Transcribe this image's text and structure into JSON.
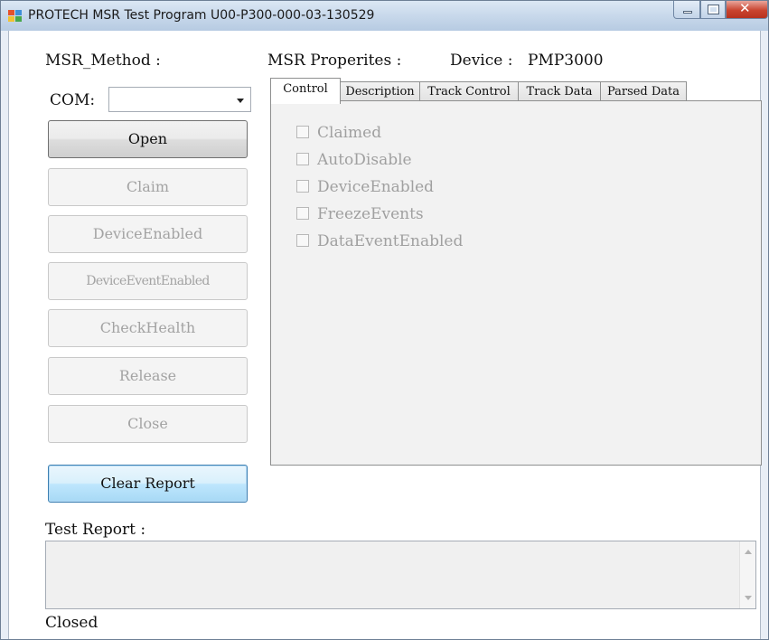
{
  "window": {
    "title": "PROTECH MSR Test Program U00-P300-000-03-130529"
  },
  "method": {
    "label": "MSR_Method :",
    "com_label": "COM:",
    "com_value": "",
    "buttons": {
      "open": "Open",
      "claim": "Claim",
      "device_enabled": "DeviceEnabled",
      "device_event_enabled": "DeviceEventEnabled",
      "check_health": "CheckHealth",
      "release": "Release",
      "close": "Close",
      "clear_report": "Clear Report"
    }
  },
  "properties": {
    "label": "MSR Properites :",
    "device_label": "Device :",
    "device_value": "PMP3000",
    "tabs": [
      {
        "label": "Control",
        "active": true
      },
      {
        "label": "Description",
        "active": false
      },
      {
        "label": "Track Control",
        "active": false
      },
      {
        "label": "Track Data",
        "active": false
      },
      {
        "label": "Parsed Data",
        "active": false
      }
    ],
    "checkboxes": [
      {
        "label": "Claimed",
        "checked": false
      },
      {
        "label": "AutoDisable",
        "checked": false
      },
      {
        "label": "DeviceEnabled",
        "checked": false
      },
      {
        "label": "FreezeEvents",
        "checked": false
      },
      {
        "label": "DataEventEnabled",
        "checked": false
      }
    ]
  },
  "report": {
    "label": "Test Report :",
    "content": "",
    "status": "Closed"
  },
  "colors": {
    "accent_focus": "#3c7fb1",
    "disabled_text": "#a3a3a3",
    "close_button": "#c9442f"
  }
}
